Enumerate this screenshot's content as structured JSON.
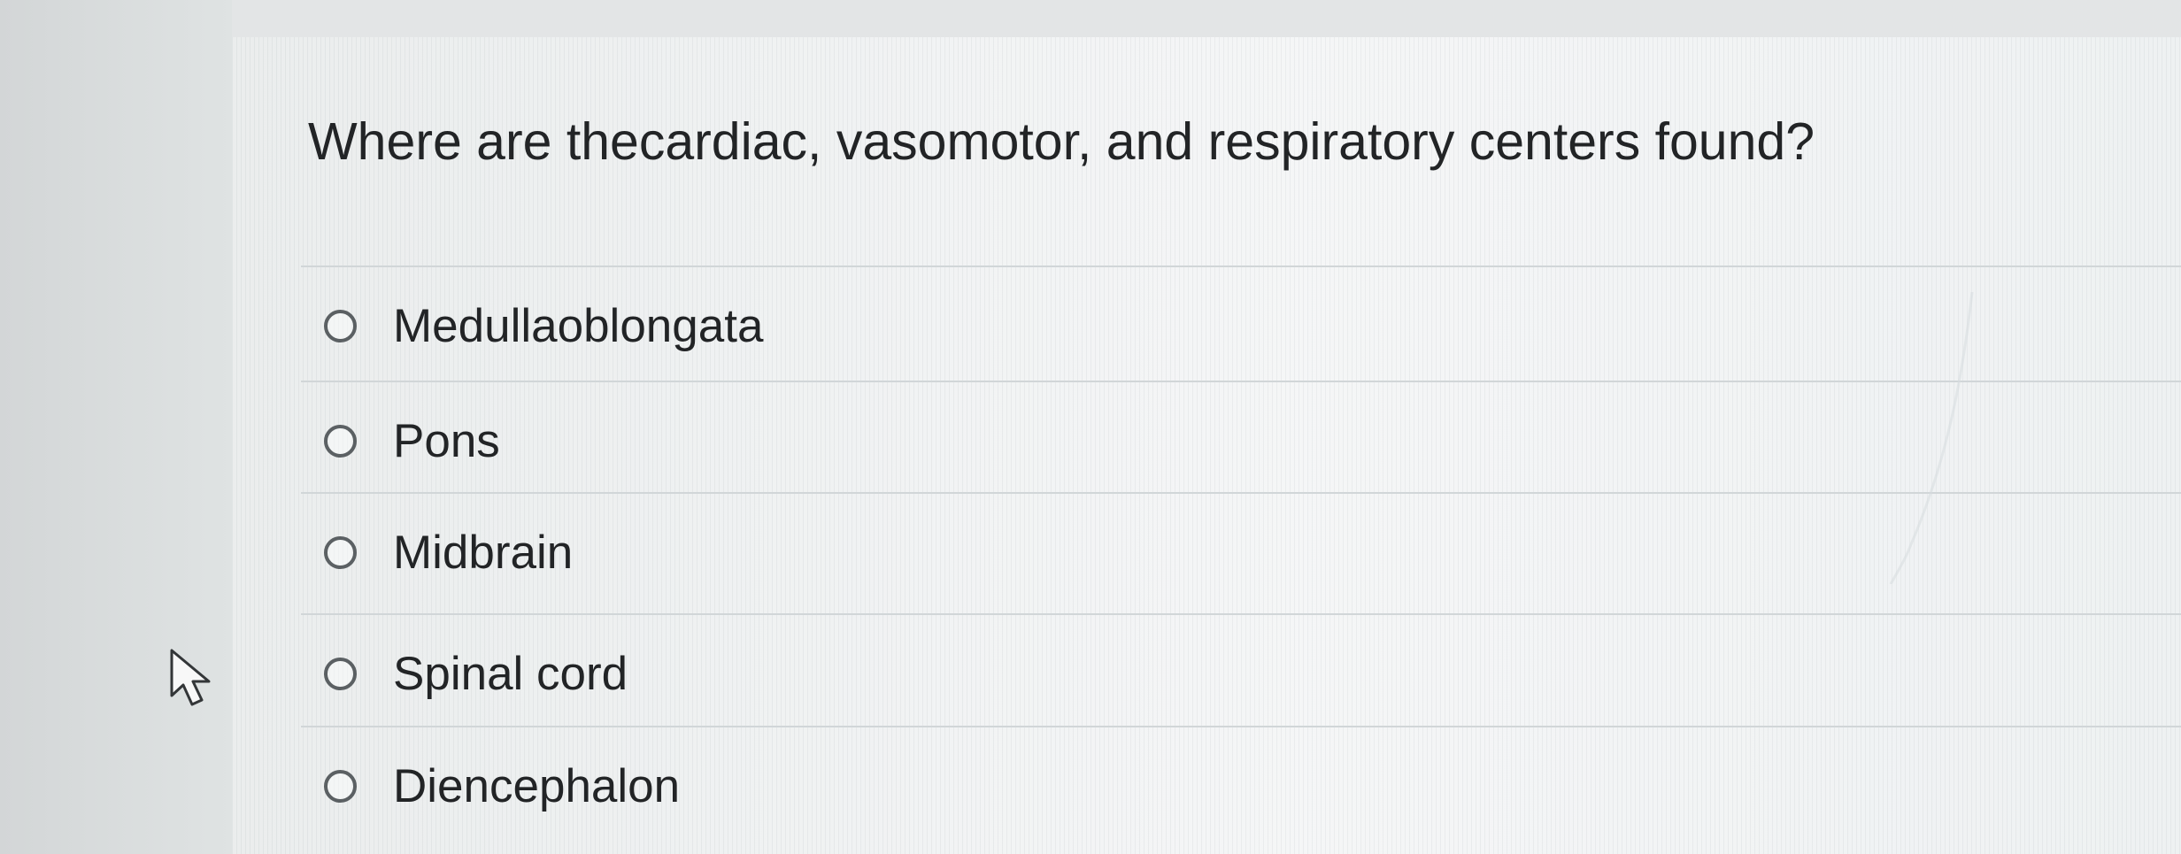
{
  "question": {
    "text": "Where are thecardiac, vasomotor, and respiratory centers found?"
  },
  "answers": [
    {
      "label": "Medullaoblongata",
      "selected": false
    },
    {
      "label": "Pons",
      "selected": false
    },
    {
      "label": "Midbrain",
      "selected": false
    },
    {
      "label": "Spinal cord",
      "selected": false
    },
    {
      "label": "Diencephalon",
      "selected": false
    }
  ],
  "icons": {
    "cursor": "mouse-pointer-icon"
  },
  "colors": {
    "text": "#222426",
    "radio_border": "#5b6063",
    "divider": "#d1d6d8"
  }
}
